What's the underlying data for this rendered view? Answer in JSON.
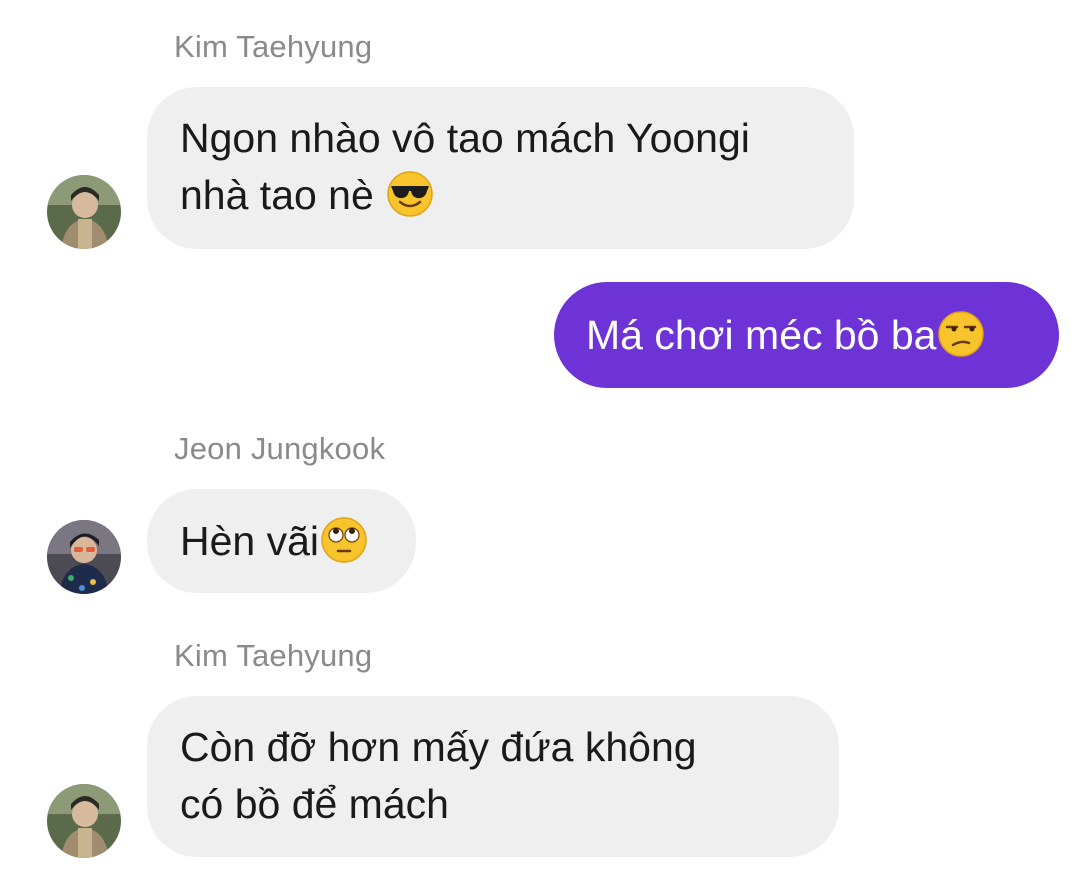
{
  "messages": [
    {
      "sender": "Kim Taehyung",
      "lines": [
        "Ngon nhào vô tao mách Yoongi",
        "nhà tao nè"
      ],
      "emoji": "smiling-face-with-sunglasses-emoji"
    },
    {
      "sender": "",
      "lines": [
        "Má chơi méc bồ ba"
      ],
      "emoji": "unamused-face-emoji"
    },
    {
      "sender": "Jeon Jungkook",
      "lines": [
        "Hèn vãi"
      ],
      "emoji": "face-with-rolling-eyes-emoji"
    },
    {
      "sender": "Kim Taehyung",
      "lines": [
        "Còn đỡ hơn mấy đứa không",
        "có bồ để mách"
      ]
    }
  ],
  "colors": {
    "incoming_bubble": "#efefef",
    "outgoing_bubble": "#6d33d6",
    "sender_name": "#8a8a8a"
  }
}
